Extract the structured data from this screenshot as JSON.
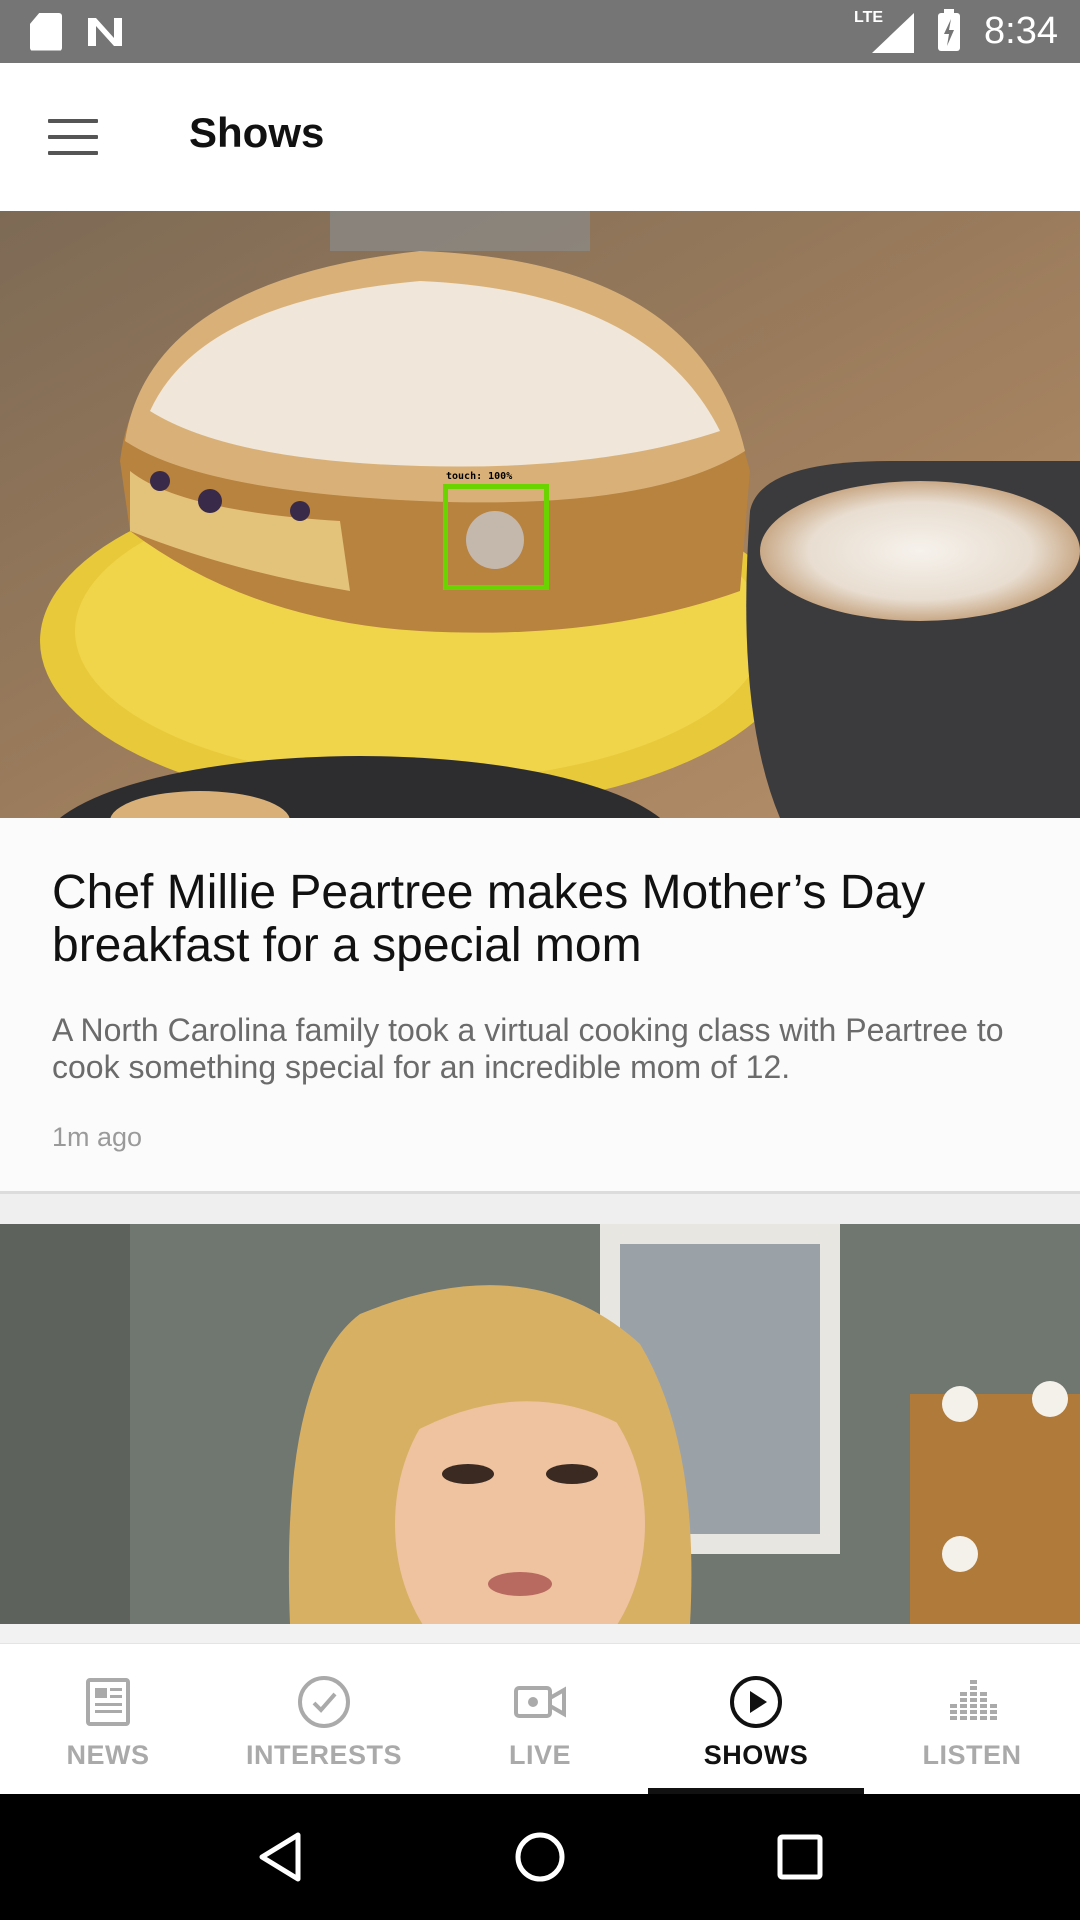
{
  "status_bar": {
    "time": "8:34",
    "network_label": "LTE"
  },
  "app_bar": {
    "title": "Shows"
  },
  "feed": [
    {
      "title": "Chef Millie Peartree makes Mother’s Day breakfast for a special mom",
      "description": "A North Carolina family took a virtual cooking class with Peartree to cook something special for an incredible mom of 12.",
      "time": "1m ago"
    }
  ],
  "touch_overlay": {
    "label": "touch: 100%"
  },
  "bottom_nav": {
    "items": [
      {
        "label": "NEWS",
        "icon": "newspaper-icon",
        "active": false
      },
      {
        "label": "INTERESTS",
        "icon": "check-circle-icon",
        "active": false
      },
      {
        "label": "LIVE",
        "icon": "video-camera-icon",
        "active": false
      },
      {
        "label": "SHOWS",
        "icon": "play-circle-icon",
        "active": true
      },
      {
        "label": "LISTEN",
        "icon": "equalizer-icon",
        "active": false
      }
    ]
  },
  "colors": {
    "status_bar": "#757575",
    "active_tab": "#111111",
    "inactive_tab": "#aaaaaa",
    "system_nav": "#000000"
  }
}
